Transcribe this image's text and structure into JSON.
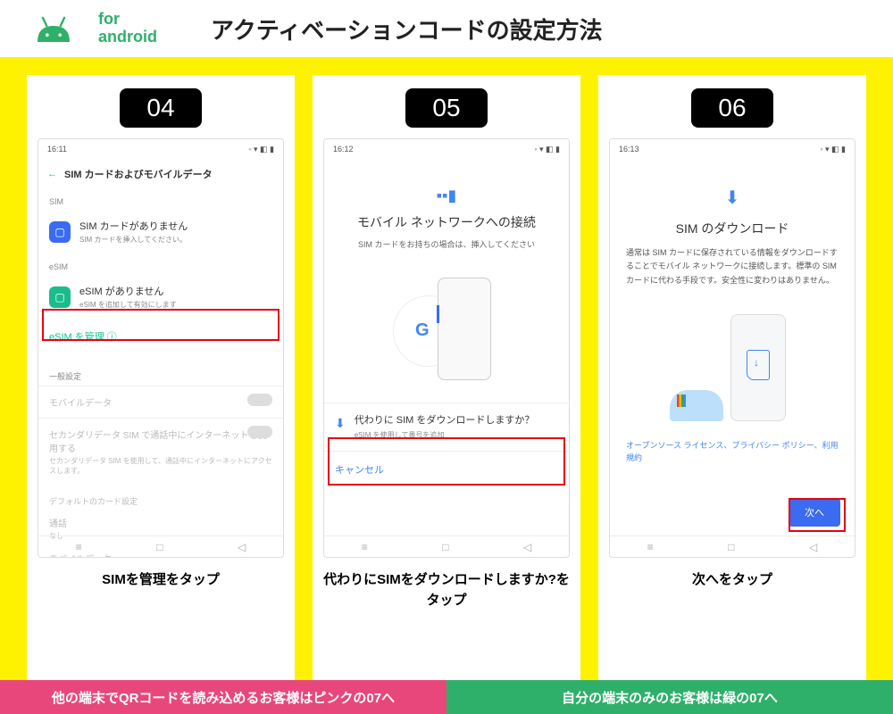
{
  "header": {
    "for": "for",
    "android": "android",
    "title": "アクティベーションコードの設定方法"
  },
  "steps": {
    "s04": {
      "num": "04",
      "caption_bold": "SIMを管理",
      "caption_rest": "をタップ"
    },
    "s05": {
      "num": "05",
      "caption_bold": "代わりにSIMをダウンロードしますか?",
      "caption_rest": "をタップ"
    },
    "s06": {
      "num": "06",
      "caption_bold": "次へ",
      "caption_rest": "をタップ"
    }
  },
  "phone04": {
    "time": "16:11",
    "title": "SIM カードおよびモバイルデータ",
    "sec_sim": "SIM",
    "nosim_t": "SIM カードがありません",
    "nosim_d": "SIM カードを挿入してください。",
    "sec_esim": "eSIM",
    "noesim_t": "eSIM がありません",
    "noesim_d": "eSIM を追加して有効にします",
    "manage": "eSIM を管理 ⓘ",
    "sec_gen": "一般設定",
    "mobile": "モバイルデータ",
    "sec_t": "セカンダリデータ SIM で通話中にインターネットを使用する",
    "sec_d": "セカンダリデータ SIM を使用して、通話中にインターネットにアクセスします。",
    "def": "デフォルトのカード設定",
    "call": "通話",
    "none": "なし",
    "md": "モバイルデータ"
  },
  "phone05": {
    "time": "16:12",
    "title": "モバイル ネットワークへの接続",
    "desc": "SIM カードをお持ちの場合は、挿入してください",
    "dl_t": "代わりに SIM をダウンロードしますか？",
    "dl_d": "eSIM を使用して番号を追加",
    "cancel": "キャンセル"
  },
  "phone06": {
    "time": "16:13",
    "title": "SIM のダウンロード",
    "desc": "通常は SIM カードに保存されている情報をダウンロードすることでモバイル ネットワークに接続します。標準の SIM カードに代わる手段です。安全性に変わりはありません。",
    "links": "オープンソース ライセンス、プライバシー ポリシー、利用規約",
    "next": "次へ"
  },
  "footer": {
    "pink": "他の端末でQRコードを読み込めるお客様はピンクの07へ",
    "green": "自分の端末のみのお客様は緑の07へ"
  }
}
